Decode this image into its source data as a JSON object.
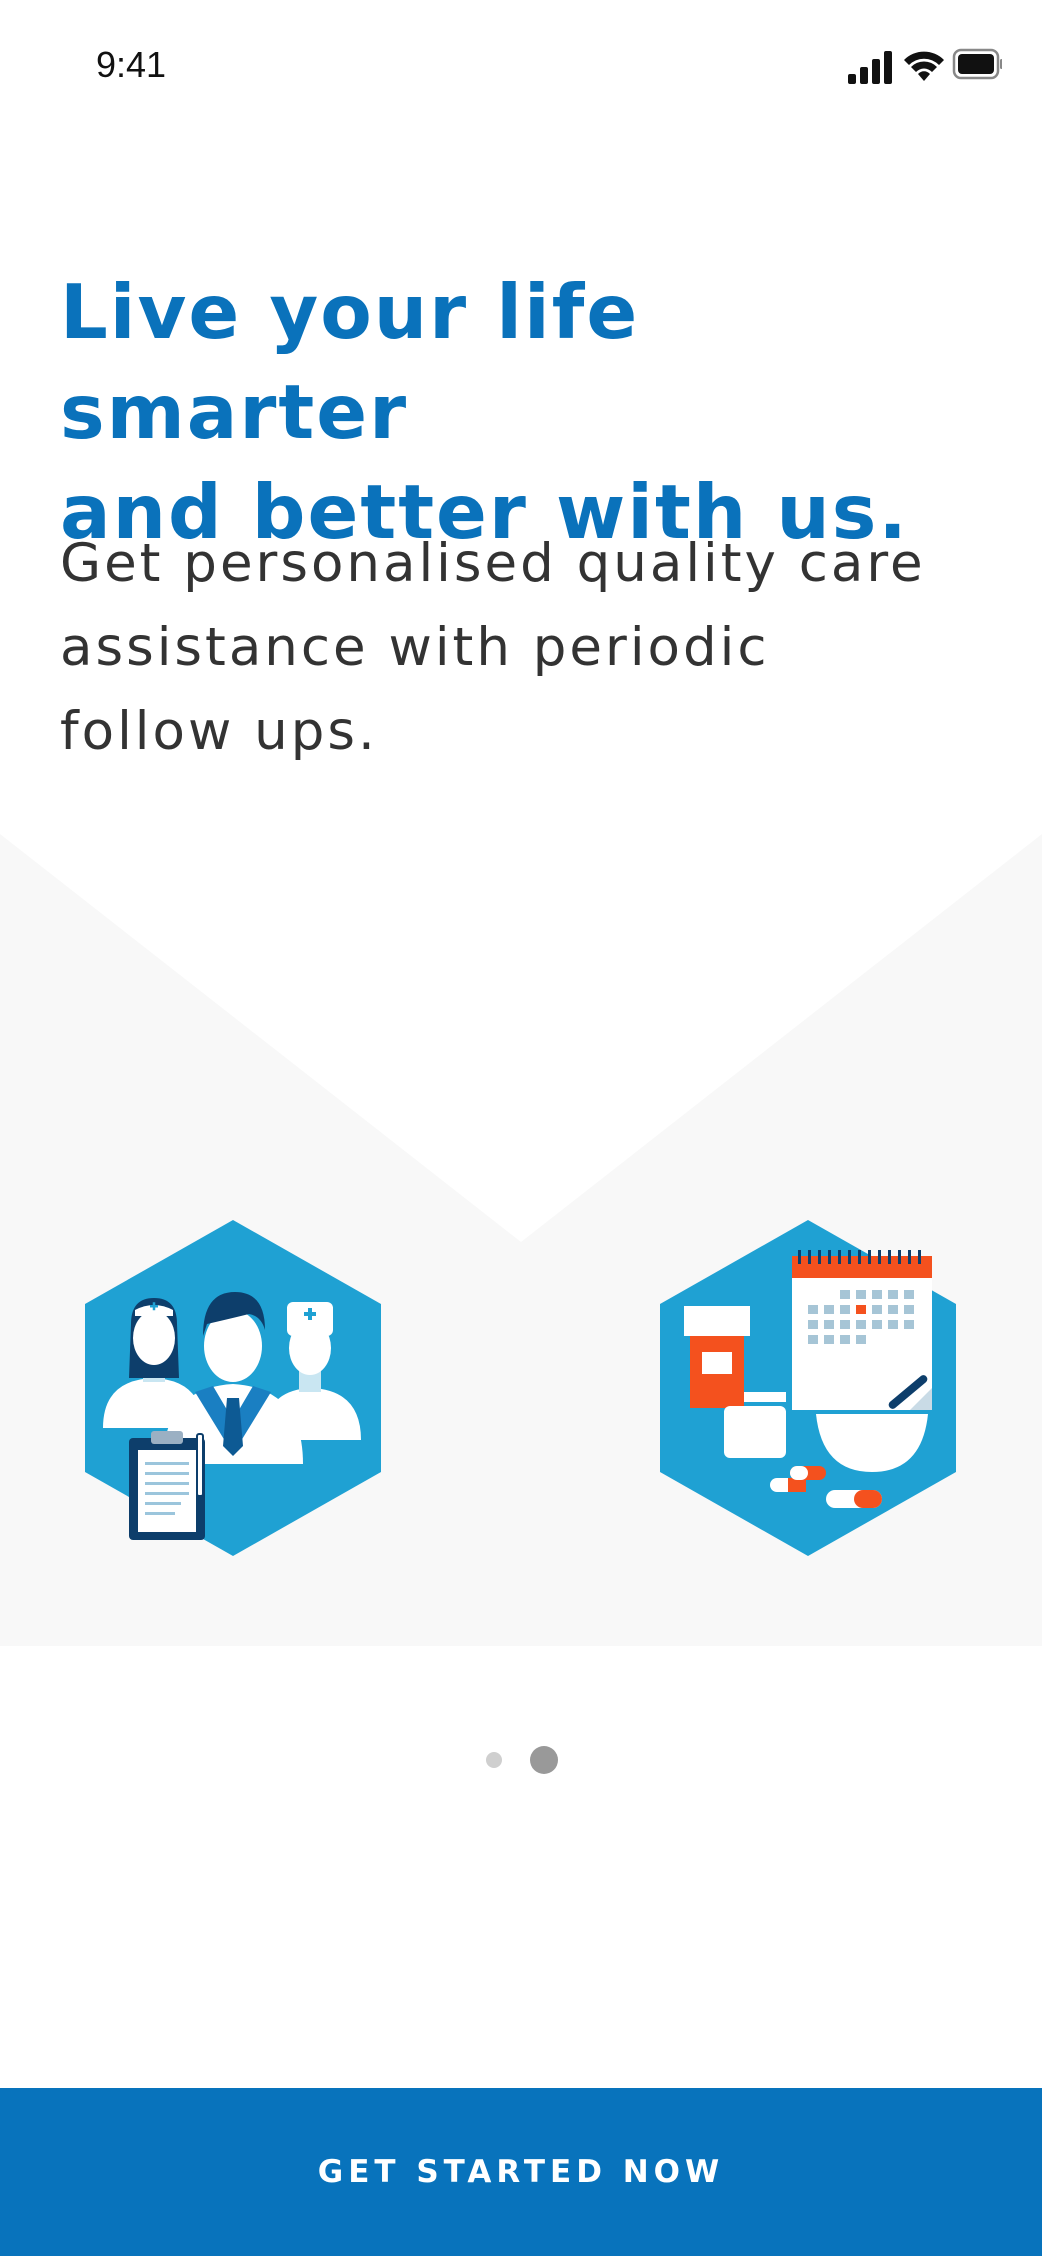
{
  "status_bar": {
    "time": "9:41",
    "icons": [
      "signal-icon",
      "wifi-icon",
      "battery-icon"
    ]
  },
  "onboarding": {
    "headline_line1": "Live your life smarter",
    "headline_line2": "and better with us.",
    "subtitle_line1": "Get personalised quality care",
    "subtitle_line2": "assistance with periodic",
    "subtitle_line3": "follow ups.",
    "illustrations": [
      "care-team-illustration",
      "medication-schedule-illustration"
    ]
  },
  "pager": {
    "count": 2,
    "active_index": 1
  },
  "cta": {
    "label": "GET STARTED NOW"
  },
  "colors": {
    "primary": "#0873bc",
    "headline": "#0a72bb",
    "illustration_bg": "#1fa1d3",
    "accent_orange": "#f4511e",
    "panel_gray": "#f8f8f8",
    "dot_inactive": "#cfcfcf",
    "dot_active": "#999999"
  }
}
